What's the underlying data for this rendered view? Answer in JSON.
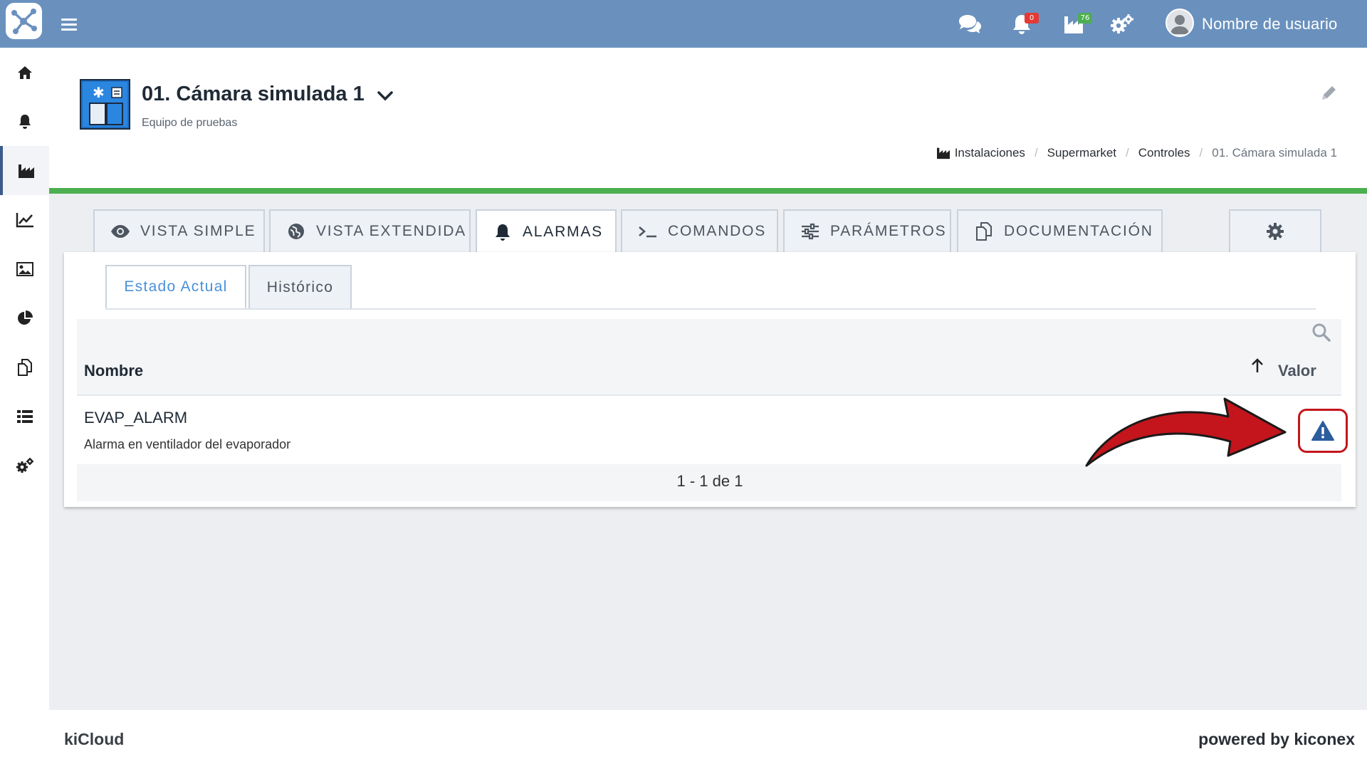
{
  "topbar": {
    "username": "Nombre de usuario",
    "notifications_count": "0",
    "installations_count": "76",
    "icons": [
      "chat-icon",
      "bell-icon",
      "factory-icon",
      "gears-icon"
    ],
    "color": "#6a91be"
  },
  "sidebar": {
    "items": [
      {
        "icon": "home-icon"
      },
      {
        "icon": "bell-icon"
      },
      {
        "icon": "factory-icon",
        "active": true
      },
      {
        "icon": "line-chart-icon"
      },
      {
        "icon": "image-icon"
      },
      {
        "icon": "pie-chart-icon"
      },
      {
        "icon": "documents-icon"
      },
      {
        "icon": "list-icon"
      },
      {
        "icon": "gears-icon"
      }
    ]
  },
  "header": {
    "title": "01. Cámara simulada 1",
    "subtitle": "Equipo de pruebas",
    "breadcrumb": [
      "Instalaciones",
      "Supermarket",
      "Controles",
      "01. Cámara simulada 1"
    ],
    "status_color": "#4caf50"
  },
  "tabs": [
    {
      "label": "VISTA SIMPLE",
      "icon": "eye-icon"
    },
    {
      "label": "VISTA EXTENDIDA",
      "icon": "globe-icon"
    },
    {
      "label": "ALARMAS",
      "icon": "bell-icon",
      "active": true
    },
    {
      "label": "COMANDOS",
      "icon": "terminal-icon"
    },
    {
      "label": "PARÁMETROS",
      "icon": "sliders-icon"
    },
    {
      "label": "DOCUMENTACIÓN",
      "icon": "documents-icon"
    }
  ],
  "subtabs": [
    {
      "label": "Estado Actual",
      "active": true
    },
    {
      "label": "Histórico"
    }
  ],
  "table": {
    "columns": [
      "Nombre",
      "Valor"
    ],
    "rows": [
      {
        "name": "EVAP_ALARM",
        "description": "Alarma en ventilador del evaporador",
        "value_icon": "warning-icon"
      }
    ],
    "pagination": "1 - 1 de 1"
  },
  "footer": {
    "left": "kiCloud",
    "right": "powered by kiconex"
  }
}
